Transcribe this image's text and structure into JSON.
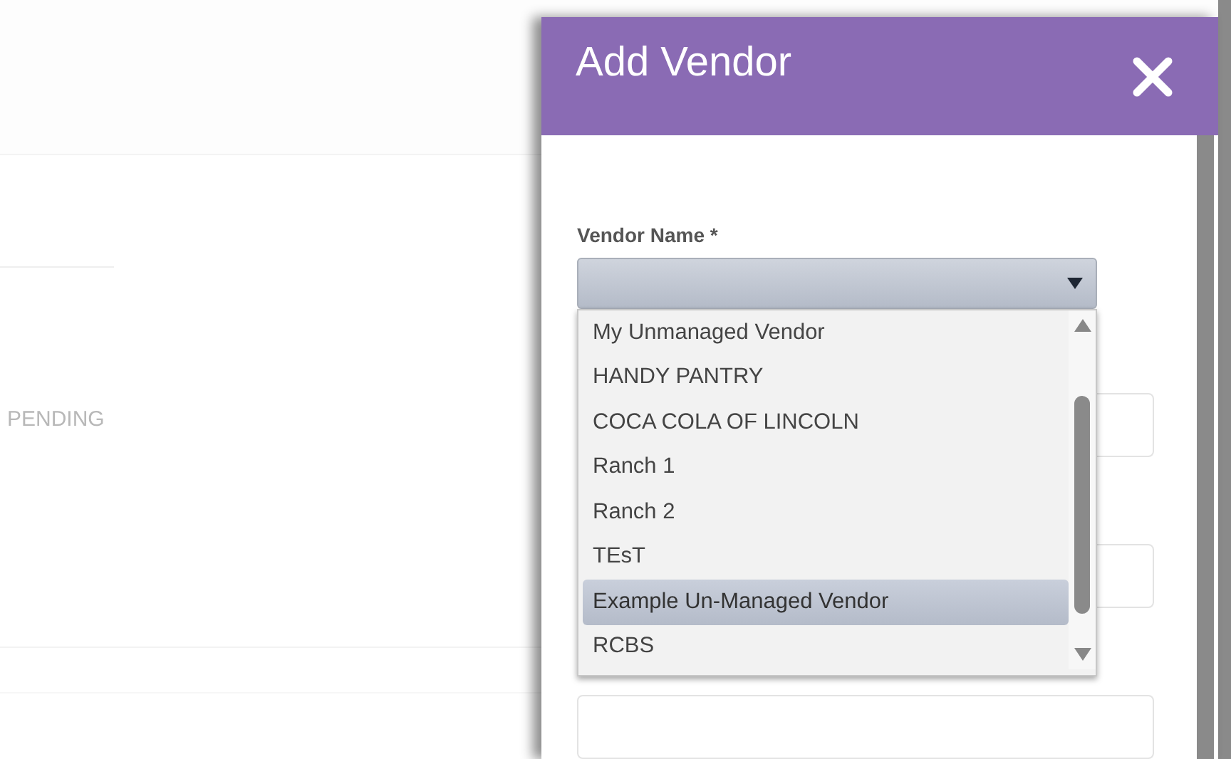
{
  "background": {
    "status": "PENDING"
  },
  "dialog": {
    "title": "Add Vendor",
    "vendor_field": {
      "label": "Vendor Name *",
      "expanded": true,
      "options": [
        {
          "label": "My Unmanaged Vendor",
          "selected": false
        },
        {
          "label": "HANDY PANTRY",
          "selected": false
        },
        {
          "label": "COCA COLA OF LINCOLN",
          "selected": false
        },
        {
          "label": "Ranch 1",
          "selected": false
        },
        {
          "label": "Ranch 2",
          "selected": false
        },
        {
          "label": "TEsT",
          "selected": false
        },
        {
          "label": "Example Un-Managed Vendor",
          "selected": true
        },
        {
          "label": "RCBS",
          "selected": false
        }
      ]
    },
    "inputs": [
      {
        "kind": "text"
      },
      {
        "kind": "text"
      },
      {
        "kind": "text"
      }
    ]
  }
}
